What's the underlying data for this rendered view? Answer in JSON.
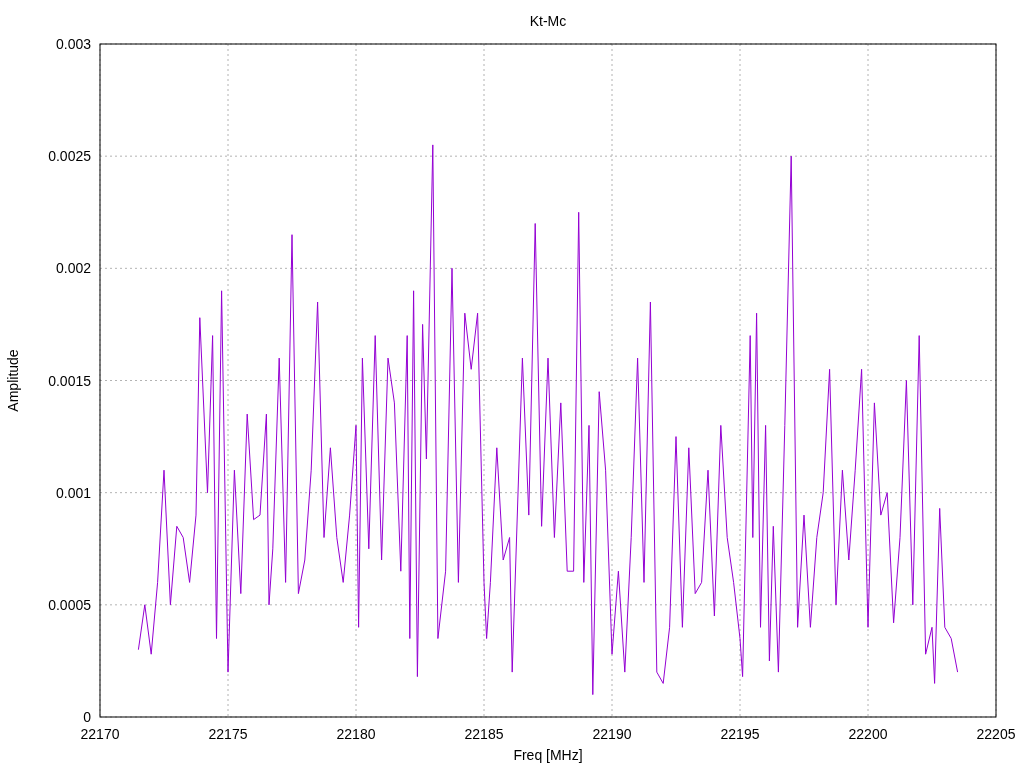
{
  "chart_data": {
    "type": "line",
    "title": "Kt-Mc",
    "xlabel": "Freq [MHz]",
    "ylabel": "Amplitude",
    "xlim": [
      22170,
      22205
    ],
    "ylim": [
      0,
      0.003
    ],
    "grid": true,
    "xticks": [
      22170,
      22175,
      22180,
      22185,
      22190,
      22195,
      22200,
      22205
    ],
    "yticks": [
      0,
      0.0005,
      0.001,
      0.0015,
      0.002,
      0.0025,
      0.003
    ],
    "x": [
      22171.5,
      22171.75,
      22172,
      22172.25,
      22172.5,
      22172.75,
      22173,
      22173.25,
      22173.5,
      22173.75,
      22173.9,
      22174.2,
      22174.4,
      22174.55,
      22174.75,
      22175,
      22175.25,
      22175.5,
      22175.75,
      22176,
      22176.25,
      22176.5,
      22176.6,
      22176.75,
      22177,
      22177.25,
      22177.5,
      22177.75,
      22178,
      22178.25,
      22178.5,
      22178.75,
      22179,
      22179.25,
      22179.5,
      22179.75,
      22180,
      22180.1,
      22180.25,
      22180.5,
      22180.75,
      22181,
      22181.25,
      22181.5,
      22181.75,
      22182,
      22182.1,
      22182.25,
      22182.4,
      22182.6,
      22182.75,
      22183,
      22183.2,
      22183.5,
      22183.75,
      22184,
      22184.25,
      22184.5,
      22184.75,
      22185,
      22185.1,
      22185.25,
      22185.5,
      22185.75,
      22186,
      22186.1,
      22186.5,
      22186.75,
      22187,
      22187.25,
      22187.5,
      22187.75,
      22188,
      22188.25,
      22188.5,
      22188.7,
      22188.9,
      22189.1,
      22189.25,
      22189.5,
      22189.75,
      22190,
      22190.25,
      22190.5,
      22190.75,
      22191,
      22191.25,
      22191.5,
      22191.75,
      22192,
      22192.25,
      22192.5,
      22192.75,
      22193,
      22193.25,
      22193.5,
      22193.75,
      22194,
      22194.25,
      22194.5,
      22194.75,
      22195,
      22195.1,
      22195.4,
      22195.5,
      22195.65,
      22195.8,
      22196,
      22196.15,
      22196.3,
      22196.5,
      22196.75,
      22197,
      22197.25,
      22197.5,
      22197.75,
      22198,
      22198.25,
      22198.5,
      22198.75,
      22199,
      22199.25,
      22199.5,
      22199.75,
      22200,
      22200.25,
      22200.5,
      22200.75,
      22201,
      22201.25,
      22201.5,
      22201.75,
      22202,
      22202.25,
      22202.5,
      22202.6,
      22202.8,
      22203,
      22203.25,
      22203.5
    ],
    "series": [
      {
        "color": "#9400d3",
        "values": [
          0.0003,
          0.0005,
          0.00028,
          0.0006,
          0.0011,
          0.0005,
          0.00085,
          0.0008,
          0.0006,
          0.0009,
          0.00178,
          0.001,
          0.0017,
          0.00035,
          0.0019,
          0.0002,
          0.0011,
          0.00055,
          0.00135,
          0.00088,
          0.0009,
          0.00135,
          0.0005,
          0.00075,
          0.0016,
          0.0006,
          0.00215,
          0.00055,
          0.0007,
          0.0011,
          0.00185,
          0.0008,
          0.0012,
          0.0008,
          0.0006,
          0.0009,
          0.0013,
          0.0004,
          0.0016,
          0.00075,
          0.0017,
          0.0007,
          0.0016,
          0.0014,
          0.00065,
          0.0017,
          0.00035,
          0.0019,
          0.00018,
          0.00175,
          0.00115,
          0.00255,
          0.00035,
          0.00065,
          0.002,
          0.0006,
          0.0018,
          0.00155,
          0.0018,
          0.0006,
          0.00035,
          0.0006,
          0.0012,
          0.0007,
          0.0008,
          0.0002,
          0.0016,
          0.0009,
          0.0022,
          0.00085,
          0.0016,
          0.0008,
          0.0014,
          0.00065,
          0.00065,
          0.00225,
          0.0006,
          0.0013,
          0.0001,
          0.00145,
          0.0011,
          0.00028,
          0.00065,
          0.0002,
          0.0008,
          0.0016,
          0.0006,
          0.00185,
          0.0002,
          0.00015,
          0.0004,
          0.00125,
          0.0004,
          0.0012,
          0.00055,
          0.0006,
          0.0011,
          0.00045,
          0.0013,
          0.0008,
          0.0006,
          0.00035,
          0.00018,
          0.0017,
          0.0008,
          0.0018,
          0.0004,
          0.0013,
          0.00025,
          0.00085,
          0.0002,
          0.0013,
          0.0025,
          0.0004,
          0.0009,
          0.0004,
          0.0008,
          0.001,
          0.00155,
          0.0005,
          0.0011,
          0.0007,
          0.0011,
          0.00155,
          0.0004,
          0.0014,
          0.0009,
          0.001,
          0.00042,
          0.0008,
          0.0015,
          0.0005,
          0.0017,
          0.00028,
          0.0004,
          0.00015,
          0.00093,
          0.0004,
          0.00035,
          0.0002
        ]
      }
    ]
  }
}
